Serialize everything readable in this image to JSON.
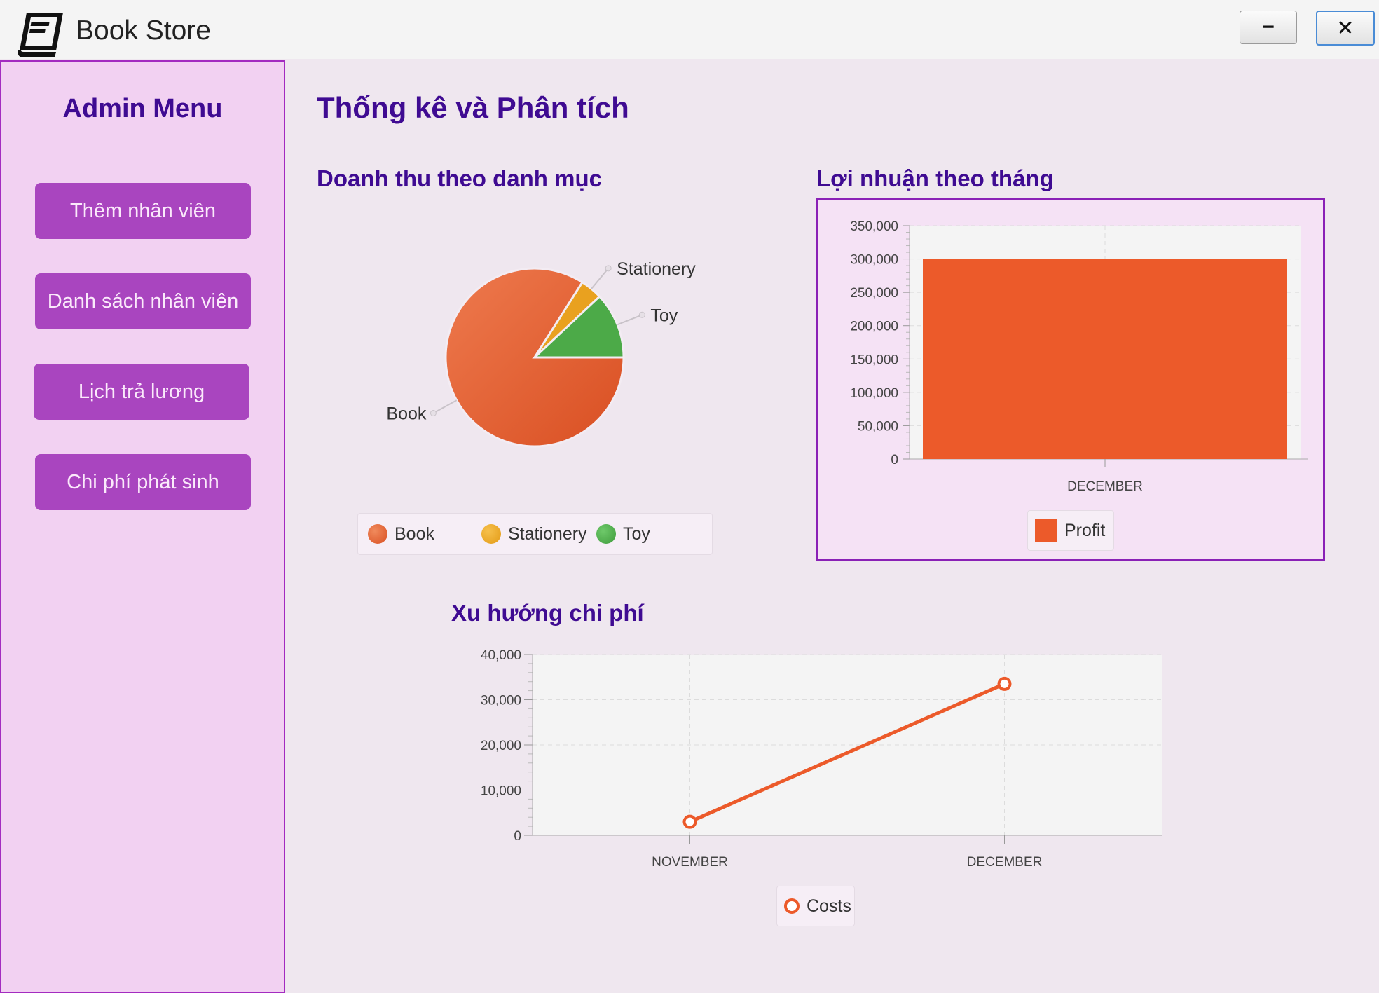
{
  "window": {
    "title": "Book Store",
    "minimize_label": "−",
    "close_label": "✕"
  },
  "sidebar": {
    "title": "Admin Menu",
    "items": [
      {
        "label": "Thêm nhân viên"
      },
      {
        "label": "Danh sách nhân viên"
      },
      {
        "label": "Lịch trả lương"
      },
      {
        "label": "Chi phí phát sinh"
      }
    ]
  },
  "main": {
    "title": "Thống kê và Phân tích",
    "pie_title": "Doanh thu theo danh mục",
    "bar_title": "Lợi nhuận theo tháng",
    "line_title": "Xu hướng chi phí"
  },
  "colors": {
    "book": "#e05a2d",
    "stationery": "#e9a11f",
    "toy": "#4caa48",
    "profit": "#ec5a2a",
    "costs": "#ec5a2a",
    "accent": "#a945bf"
  },
  "chart_data": [
    {
      "type": "pie",
      "title": "Doanh thu theo danh mục",
      "labels": [
        "Book",
        "Stationery",
        "Toy"
      ],
      "values": [
        84,
        4,
        12
      ],
      "legend": "bottom"
    },
    {
      "type": "bar",
      "title": "Lợi nhuận theo tháng",
      "categories": [
        "DECEMBER"
      ],
      "series": [
        {
          "name": "Profit",
          "values": [
            300000
          ]
        }
      ],
      "ylim": [
        0,
        350000
      ],
      "yticks": [
        "0",
        "50,000",
        "100,000",
        "150,000",
        "200,000",
        "250,000",
        "300,000",
        "350,000"
      ],
      "legend": "bottom"
    },
    {
      "type": "line",
      "title": "Xu hướng chi phí",
      "categories": [
        "NOVEMBER",
        "DECEMBER"
      ],
      "series": [
        {
          "name": "Costs",
          "values": [
            3000,
            33500
          ]
        }
      ],
      "ylim": [
        0,
        40000
      ],
      "yticks": [
        "0",
        "10,000",
        "20,000",
        "30,000",
        "40,000"
      ],
      "legend": "bottom"
    }
  ]
}
